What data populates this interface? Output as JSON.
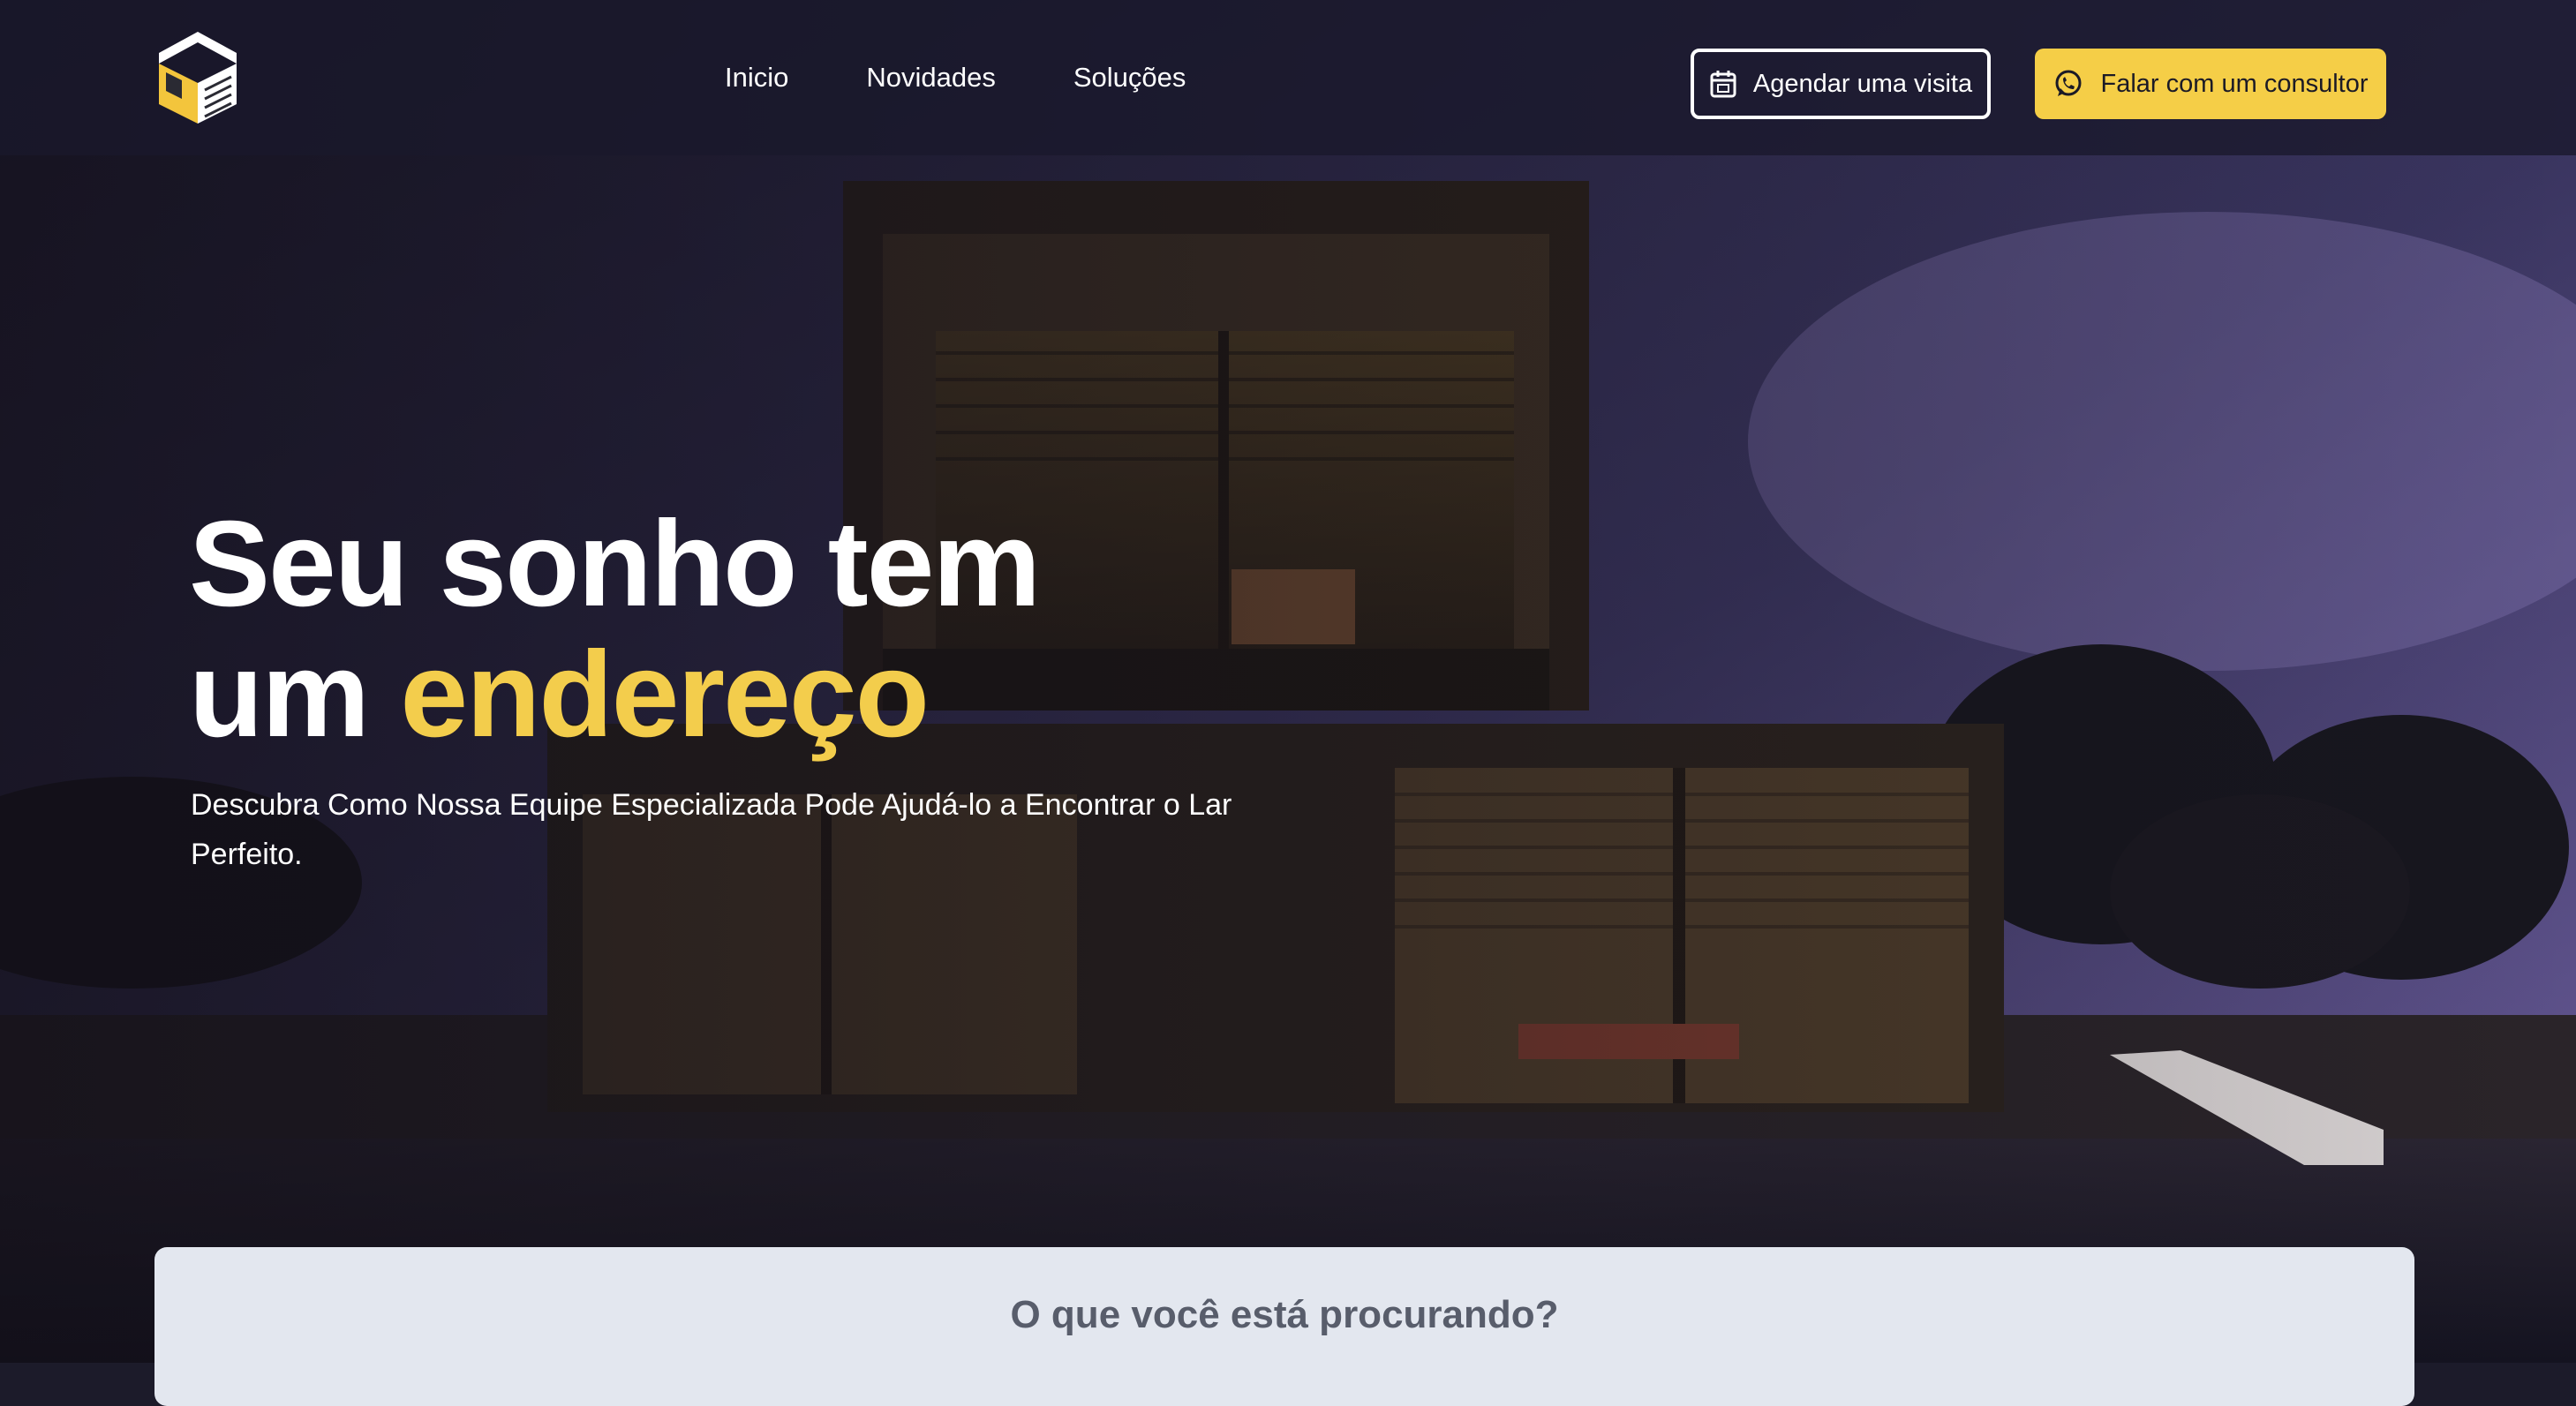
{
  "header": {
    "logo_icon": "house-logo-icon",
    "nav": [
      "Inicio",
      "Novidades",
      "Soluções"
    ],
    "visit_button": {
      "label": "Agendar uma visita",
      "icon": "calendar-icon"
    },
    "consult_button": {
      "label": "Falar com um consultor",
      "icon": "whatsapp-icon"
    }
  },
  "hero": {
    "title_line1": "Seu sonho tem",
    "title_line2_plain": "um ",
    "title_line2_accent": "endereço",
    "subtitle": "Descubra Como Nossa Equipe Especializada Pode Ajudá-lo a Encontrar o Lar Perfeito.",
    "background": "modern-house-night-photo"
  },
  "search": {
    "title": "O que você está procurando?"
  },
  "colors": {
    "accent": "#f5ce47",
    "header_bg": "#19182c",
    "card_bg": "#e3e7ef",
    "title_accent": "#f3cd4c"
  }
}
